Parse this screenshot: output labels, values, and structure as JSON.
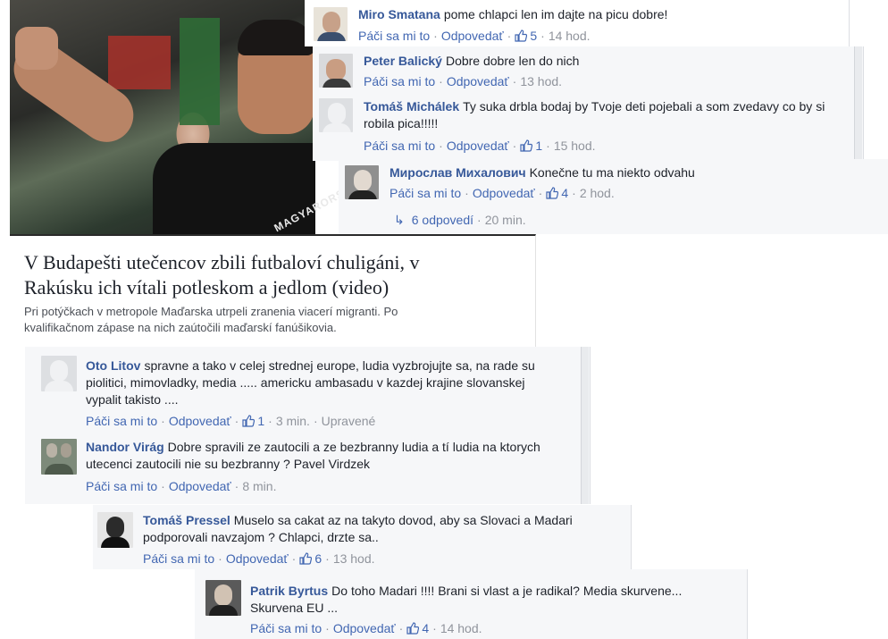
{
  "article": {
    "title": "V Budapešti utečencov zbili futbaloví chuligáni, v Rakúsku ich vítali potleskom a jedlom (video)",
    "description": "Pri potýčkach v metropole Maďarska utrpeli zranenia viacerí migranti. Po kvalifikačnom zápase na nich zaútočili maďarskí fanúšikovia.",
    "photo_text": "MAGYARORSZÁG"
  },
  "actions": {
    "like": "Páči sa mi to",
    "reply": "Odpovedať",
    "edited": "Upravené"
  },
  "comments": [
    {
      "name": "Miro Smatana",
      "text": "pome chlapci len im dajte na picu dobre!",
      "likes": "5",
      "time": "14 hod."
    },
    {
      "name": "Peter Balický",
      "text": "Dobre dobre len do nich",
      "likes": "",
      "time": "13 hod."
    },
    {
      "name": "Tomáš Michálek",
      "text": "Ty suka drbla bodaj by Tvoje deti pojebali a som zvedavy co by si robila pica!!!!!",
      "likes": "1",
      "time": "15 hod."
    },
    {
      "name": "Мирослав Михалович",
      "text": "Konečne tu ma niekto odvahu",
      "likes": "4",
      "time": "2 hod.",
      "replies": "6 odpovedí",
      "replies_time": "20 min."
    },
    {
      "name": "Oto Litov",
      "text": "spravne a tako v celej strednej europe, ludia vyzbrojujte sa, na rade su piolitici, mimovladky, media ..... americku ambasadu v kazdej krajine slovanskej vypalit takisto ....",
      "likes": "1",
      "time": "3 min."
    },
    {
      "name": "Nandor Virág",
      "text": "Dobre spravili ze zautocili a ze bezbranny ludia a tí ludia na ktorych utecenci zautocili nie su bezbranny ? Pavel Virdzek",
      "likes": "",
      "time": "8 min."
    },
    {
      "name": "Tomáš Pressel",
      "text": "Muselo sa cakat az na takyto dovod, aby sa Slovaci a Madari podporovali navzajom ? Chlapci, drzte sa..",
      "likes": "6",
      "time": "13 hod."
    },
    {
      "name": "Patrik Byrtus",
      "text": "Do toho Madari !!!! Brani si vlast a je radikal? Media skurvene... Skurvena EU ...",
      "likes": "4",
      "time": "14 hod."
    }
  ]
}
